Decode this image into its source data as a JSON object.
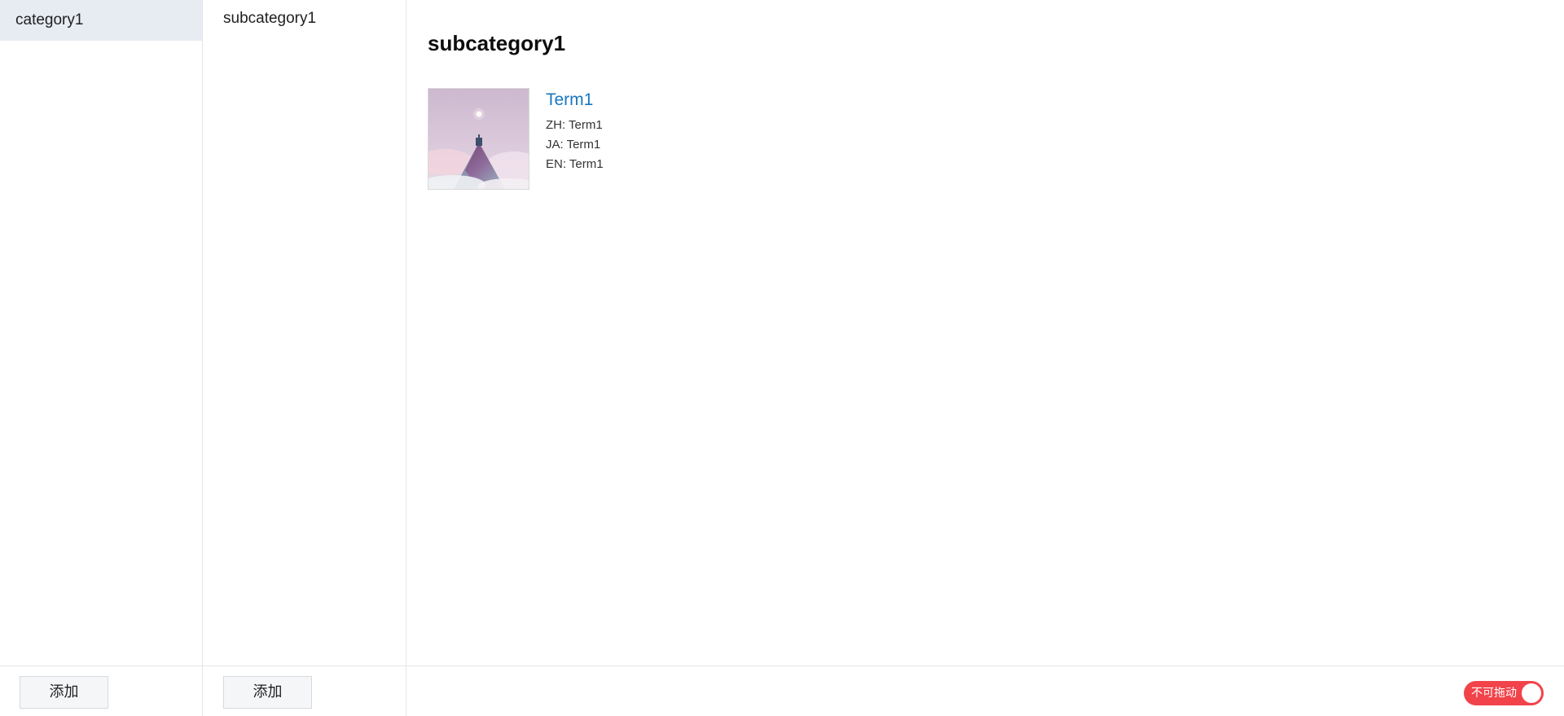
{
  "categories": {
    "items": [
      {
        "label": "category1",
        "selected": true
      }
    ],
    "add_label": "添加"
  },
  "subcategories": {
    "items": [
      {
        "label": "subcategory1",
        "selected": true
      }
    ],
    "add_label": "添加"
  },
  "main": {
    "title": "subcategory1",
    "terms": [
      {
        "name": "Term1",
        "zh": "ZH: Term1",
        "ja": "JA: Term1",
        "en": "EN: Term1",
        "thumbnail_icon": "mountain-artwork"
      }
    ]
  },
  "drag_toggle": {
    "label": "不可拖动",
    "state": "off",
    "color": "#f2434a"
  },
  "colors": {
    "selected_bg": "#e7ebf2",
    "link": "#1977c0",
    "border": "#e3e6ea"
  }
}
